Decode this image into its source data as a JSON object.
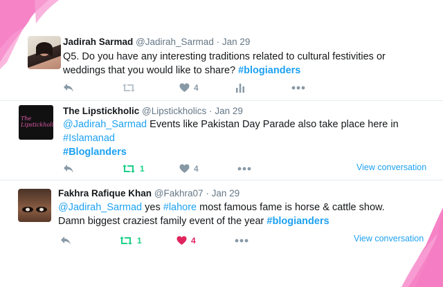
{
  "tweets": [
    {
      "name": "Jadirah Sarmad",
      "handle": "@Jadirah_Sarmad",
      "date": "Jan 29",
      "separator": "·",
      "line1": "Q5. Do you have any interesting traditions related to cultural festivities or",
      "line2_text": "weddings that you would like to share? ",
      "line2_tag": "#blogianders",
      "retweets": "",
      "likes": "4",
      "view_conversation": ""
    },
    {
      "name": "The Lipstickholic",
      "handle": "@Lipstickholics",
      "date": "Jan 29",
      "separator": "·",
      "mention": "@Jadirah_Sarmad",
      "line1_text": " Events like Pakistan Day Parade also take place here in",
      "line2_tag": "#Islamanad",
      "line3_tag": "#Bloglanders",
      "avatar_text": "The Lipstickholic",
      "retweets": "1",
      "likes": "4",
      "view_conversation": "View conversation"
    },
    {
      "name": "Fakhra Rafique Khan",
      "handle": "@Fakhra07",
      "date": "Jan 29",
      "separator": "·",
      "mention": "@Jadirah_Sarmad",
      "line1_mid": " yes ",
      "line1_tag": "#lahore",
      "line1_end": " most famous fame is horse & cattle show.",
      "line2_text": "Damn biggest craziest family event of the year ",
      "line2_tag": "#blogianders",
      "retweets": "1",
      "likes": "4",
      "view_conversation": "View conversation"
    }
  ],
  "colors": {
    "link": "#1da1f2",
    "retweet_active": "#19cf86",
    "like_active": "#e0245e",
    "icon_inactive": "#8899a6",
    "decor_pink": "#f47cc3"
  },
  "icons": [
    "reply-icon",
    "retweet-icon",
    "like-icon",
    "analytics-icon",
    "more-icon"
  ]
}
